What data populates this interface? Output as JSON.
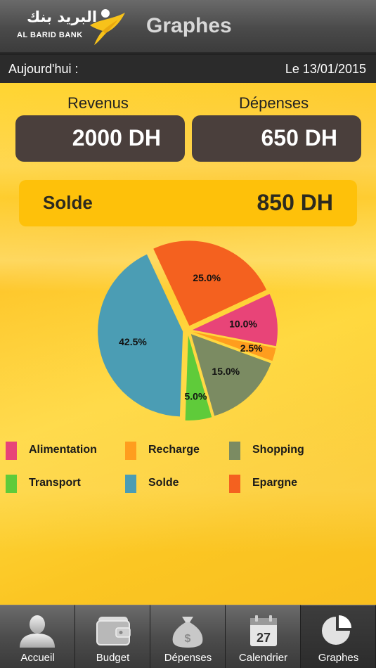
{
  "header": {
    "logo_arabic": "البريد بنك",
    "logo_text": "AL BARID BANK",
    "title": "Graphes"
  },
  "datebar": {
    "today_label": "Aujourd'hui :",
    "date": "Le 13/01/2015"
  },
  "summary": {
    "revenus_label": "Revenus",
    "revenus_value": "2000 DH",
    "depenses_label": "Dépenses",
    "depenses_value": "650 DH",
    "solde_label": "Solde",
    "solde_value": "850 DH"
  },
  "chart_data": {
    "type": "pie",
    "categories": [
      "Alimentation",
      "Recharge",
      "Shopping",
      "Transport",
      "Solde",
      "Epargne"
    ],
    "values": [
      10.0,
      2.5,
      15.0,
      5.0,
      42.5,
      25.0
    ],
    "labels": [
      "10.0%",
      "2.5%",
      "15.0%",
      "5.0%",
      "42.5%",
      "25.0%"
    ],
    "colors": [
      "#e84478",
      "#ff9d1e",
      "#7b8b62",
      "#5fcb3a",
      "#4b9db4",
      "#f4611f"
    ],
    "legend": "bottom"
  },
  "tabs": [
    {
      "label": "Accueil",
      "icon": "user-icon",
      "active": false
    },
    {
      "label": "Budget",
      "icon": "wallet-icon",
      "active": false
    },
    {
      "label": "Dépenses",
      "icon": "money-bag-icon",
      "active": false
    },
    {
      "label": "Calendrier",
      "icon": "calendar-icon",
      "active": false,
      "day": "27"
    },
    {
      "label": "Graphes",
      "icon": "pie-chart-icon",
      "active": true
    }
  ]
}
